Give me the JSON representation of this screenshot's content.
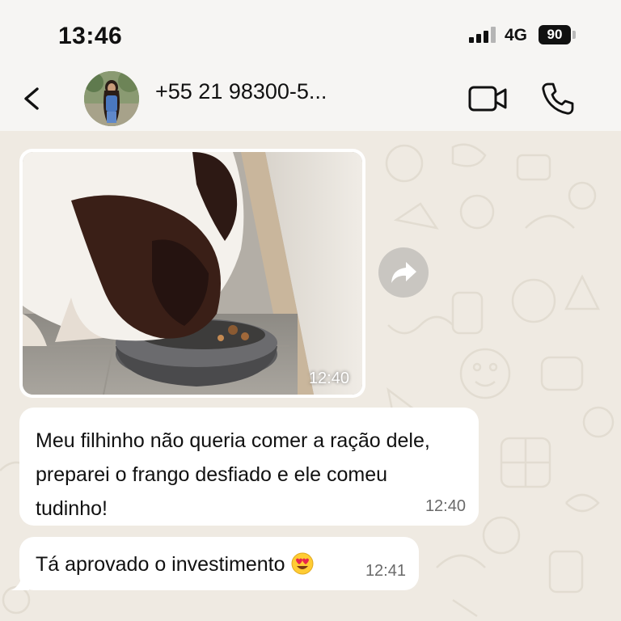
{
  "status_bar": {
    "time": "13:46",
    "network": "4G",
    "battery": "90"
  },
  "header": {
    "contact_name": "+55 21 98300-5..."
  },
  "messages": [
    {
      "type": "image",
      "time": "12:40",
      "image_description_icon": "dog-photo"
    },
    {
      "type": "text",
      "text": "Meu filhinho não queria comer a ração dele, preparei o frango desfiado e ele comeu tudinho!",
      "time": "12:40"
    },
    {
      "type": "text",
      "text": "Tá aprovado o investimento",
      "emoji": "heart-eyes-emoji",
      "time": "12:41"
    }
  ],
  "colors": {
    "chat_background": "#efeae2",
    "bubble": "#ffffff",
    "timestamp": "#6a6a6a",
    "forward_button": "#c9c6c1"
  }
}
